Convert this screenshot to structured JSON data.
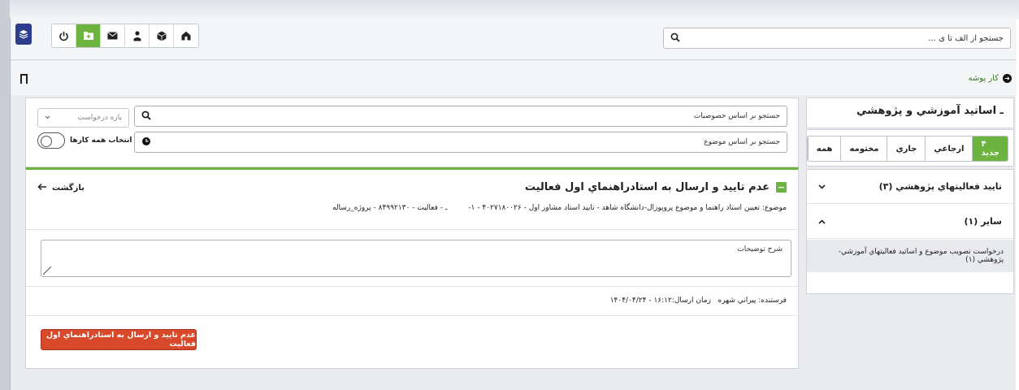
{
  "toolbar": {
    "brand_icon": "layers-icon",
    "icons": [
      "power-icon",
      "folder-add-icon",
      "mail-icon",
      "user-icon",
      "cube-icon",
      "home-icon"
    ],
    "search_placeholder": "جستجو از الف تا ی ...",
    "accent": "#6db33f"
  },
  "breadcrumb": {
    "label": "کار پوشه"
  },
  "sidebar": {
    "title": "ـ اساتید آموزشي و پژوهشي",
    "tabs": [
      {
        "label": "۴ جديد",
        "active": true
      },
      {
        "label": "ارجاعي",
        "active": false
      },
      {
        "label": "جاري",
        "active": false
      },
      {
        "label": "مختومه",
        "active": false
      },
      {
        "label": "همه",
        "active": false
      }
    ],
    "categories": [
      {
        "label": "تاييد فعاليتهاي پژوهشي (۳)",
        "expanded": false
      },
      {
        "label": "ساير (۱)",
        "expanded": true
      }
    ],
    "sub_item": "درخواست تصويب موضوع و اساتيد فعاليتهاي آموزشي-پژوهشي (۱)"
  },
  "filters": {
    "search_properties": "جستجو بر اساس خصوصيات",
    "search_subject": "جستجو بر اساس موضوع",
    "range_select": "بازه درخواست",
    "select_all_label": "انتخاب همه کارها"
  },
  "task": {
    "title": "عدم تاييد و ارسال به استادراهنماي اول فعاليت",
    "back_label": "بازگشت",
    "subject_line": "موضوع: تعيين استاد راهنما و موضوع پروپوزال-دانشگاه شاهد - تاييد استاد مشاور اول - ۴۰۲۷۱۸۰۰۲۶ - ۱-         ـ - فعاليت - ۸۴۹۹۲۱۳۰ - پروژه_رساله",
    "description_placeholder": "شرح توضيحات",
    "meta": "فرستنده: پيراني شهره   زمان ارسال:۱۶:۱۲ - ۱۴۰۴/۰۴/۲۴",
    "action_label": "عدم تاييد و ارسال به استادراهنماي اول فعاليت",
    "action_color": "#d7492a"
  }
}
